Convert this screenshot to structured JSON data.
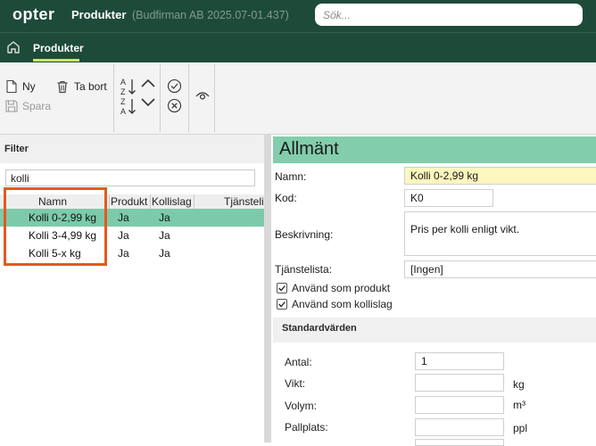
{
  "topbar": {
    "logo": "opter",
    "title": "Produkter",
    "subtitle": "(Budfirman AB 2025.07-01.437)",
    "search_placeholder": "Sök..."
  },
  "nav": {
    "home_icon": "home-icon",
    "active_tab": "Produkter",
    "accent": "#c8e36b"
  },
  "toolbar": {
    "new_label": "Ny",
    "delete_label": "Ta bort",
    "save_label": "Spara"
  },
  "filter": {
    "title": "Filter",
    "value": "kolli"
  },
  "grid": {
    "columns": [
      "Namn",
      "Produkt",
      "Kollislag",
      "Tjänsteli"
    ],
    "rows": [
      {
        "name": "Kolli 0-2,99 kg",
        "produkt": "Ja",
        "kollislag": "Ja",
        "selected": true
      },
      {
        "name": "Kolli 3-4,99 kg",
        "produkt": "Ja",
        "kollislag": "Ja",
        "selected": false
      },
      {
        "name": "Kolli 5-x kg",
        "produkt": "Ja",
        "kollislag": "Ja",
        "selected": false
      }
    ],
    "highlight_color": "#e8571f"
  },
  "detail": {
    "section_title": "Allmänt",
    "name_label": "Namn:",
    "name_value": "Kolli 0-2,99 kg",
    "code_label": "Kod:",
    "code_value": "K0",
    "desc_label": "Beskrivning:",
    "desc_value": "Pris per kolli enligt vikt.",
    "servicelist_label": "Tjänstelista:",
    "servicelist_value": "[Ingen]",
    "use_as_product": "Använd som produkt",
    "use_as_product_checked": true,
    "use_as_packagetype": "Använd som kollislag",
    "use_as_packagetype_checked": true,
    "defaults_title": "Standardvärden",
    "antal_label": "Antal:",
    "antal_value": "1",
    "vikt_label": "Vikt:",
    "vikt_value": "",
    "vikt_unit": "kg",
    "volym_label": "Volym:",
    "volym_value": "",
    "volym_unit": "m³",
    "pallplats_label": "Pallplats:",
    "pallplats_value": "",
    "pallplats_unit": "ppl"
  }
}
